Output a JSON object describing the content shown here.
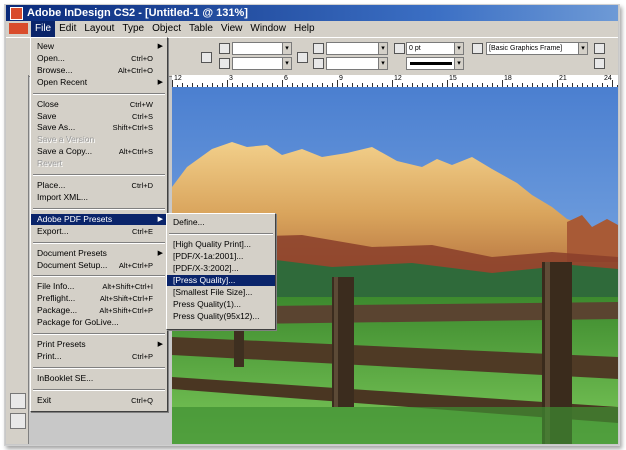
{
  "window": {
    "title": "Adobe InDesign CS2 - [Untitled-1 @ 131%]"
  },
  "menubar": {
    "items": [
      "File",
      "Edit",
      "Layout",
      "Type",
      "Object",
      "Table",
      "View",
      "Window",
      "Help"
    ]
  },
  "control_bar": {
    "stroke_weight": "0 pt",
    "object_style": "[Basic Graphics Frame]"
  },
  "ruler": {
    "labels": [
      "12",
      "3",
      "6",
      "9",
      "12",
      "15",
      "18",
      "21",
      "24"
    ]
  },
  "file_menu": [
    {
      "label": "New",
      "arrow": "▶"
    },
    {
      "label": "Open...",
      "shortcut": "Ctrl+O"
    },
    {
      "label": "Browse...",
      "shortcut": "Alt+Ctrl+O"
    },
    {
      "label": "Open Recent",
      "arrow": "▶"
    },
    {
      "label": "Close",
      "shortcut": "Ctrl+W"
    },
    {
      "label": "Save",
      "shortcut": "Ctrl+S"
    },
    {
      "label": "Save As...",
      "shortcut": "Shift+Ctrl+S"
    },
    {
      "label": "Save a Version",
      "disabled": true
    },
    {
      "label": "Save a Copy...",
      "shortcut": "Alt+Ctrl+S"
    },
    {
      "label": "Revert",
      "disabled": true
    },
    {
      "label": "Place...",
      "shortcut": "Ctrl+D"
    },
    {
      "label": "Import XML..."
    },
    {
      "label": "Adobe PDF Presets",
      "arrow": "▶",
      "highlight": true
    },
    {
      "label": "Export...",
      "shortcut": "Ctrl+E"
    },
    {
      "label": "Document Presets",
      "arrow": "▶"
    },
    {
      "label": "Document Setup...",
      "shortcut": "Alt+Ctrl+P"
    },
    {
      "label": "File Info...",
      "shortcut": "Alt+Shift+Ctrl+I"
    },
    {
      "label": "Preflight...",
      "shortcut": "Alt+Shift+Ctrl+F"
    },
    {
      "label": "Package...",
      "shortcut": "Alt+Shift+Ctrl+P"
    },
    {
      "label": "Package for GoLive..."
    },
    {
      "label": "Print Presets",
      "arrow": "▶"
    },
    {
      "label": "Print...",
      "shortcut": "Ctrl+P"
    },
    {
      "label": "InBooklet SE..."
    },
    {
      "label": "Exit",
      "shortcut": "Ctrl+Q"
    }
  ],
  "pdf_submenu": [
    {
      "label": "Define..."
    },
    {
      "label": "[High Quality Print]..."
    },
    {
      "label": "[PDF/X-1a:2001]..."
    },
    {
      "label": "[PDF/X-3:2002]..."
    },
    {
      "label": "[Press Quality]...",
      "highlight": true
    },
    {
      "label": "[Smallest File Size]..."
    },
    {
      "label": "Press Quality(1)..."
    },
    {
      "label": "Press Quality(95x12)..."
    }
  ]
}
